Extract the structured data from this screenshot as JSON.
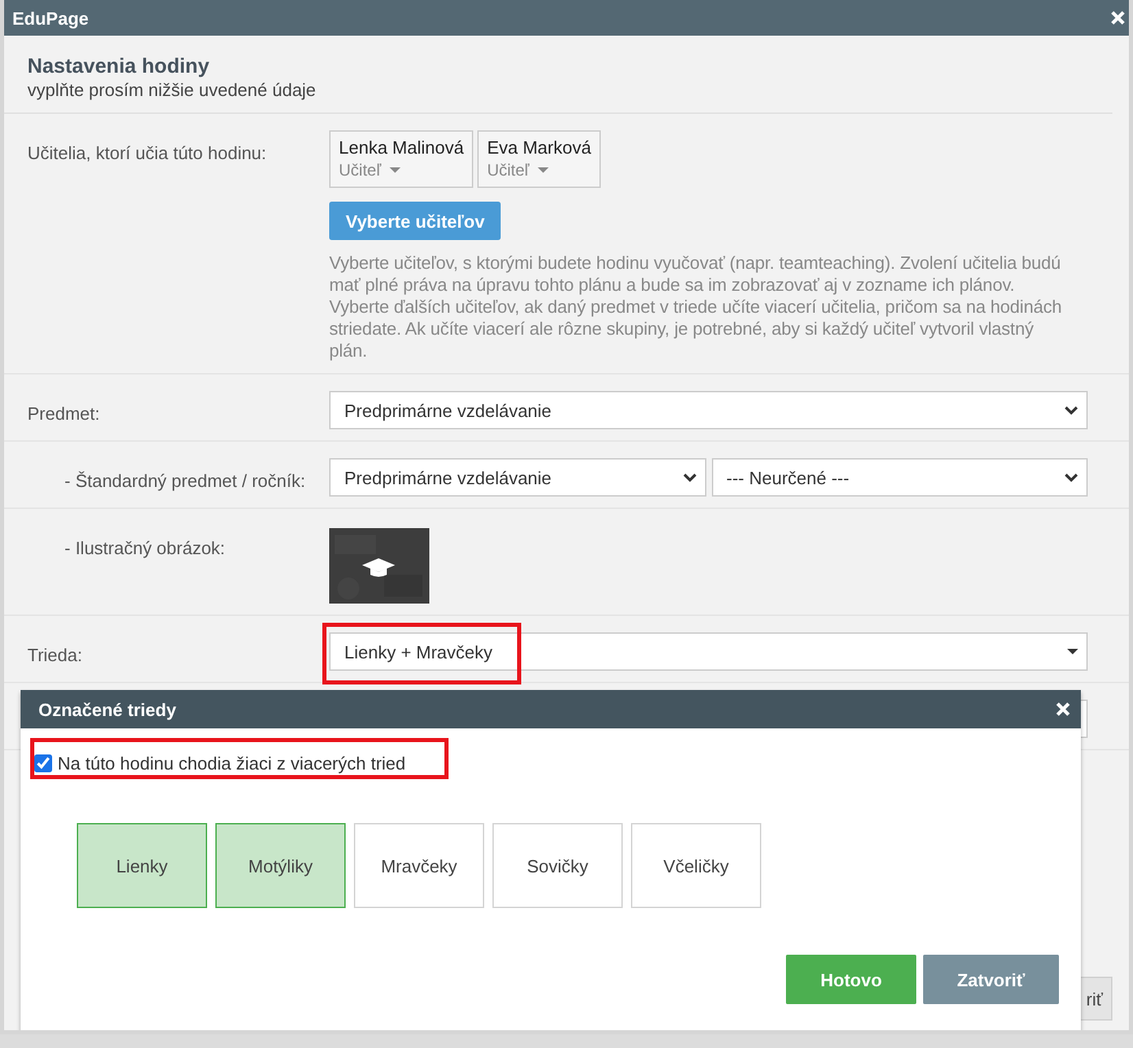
{
  "window": {
    "title": "EduPage"
  },
  "form": {
    "title": "Nastavenia hodiny",
    "subtitle": "vyplňte prosím nižšie uvedené údaje",
    "teachers": {
      "label": "Učitelia, ktorí učia túto hodinu:",
      "items": [
        {
          "name": "Lenka Malinová",
          "role": "Učiteľ"
        },
        {
          "name": "Eva Marková",
          "role": "Učiteľ"
        }
      ],
      "button": "Vyberte učiteľov",
      "help": "Vyberte učiteľov, s ktorými budete hodinu vyučovať (napr. teamteaching). Zvolení učitelia budú mať plné práva na úpravu tohto plánu a bude sa im zobrazovať aj v zozname ich plánov. Vyberte ďalších učiteľov, ak daný predmet v triede učíte viacerí učitelia, pričom sa na hodinách striedate. Ak učíte viacerí ale rôzne skupiny, je potrebné, aby si každý učiteľ vytvoril vlastný plán."
    },
    "subject": {
      "label": "Predmet:",
      "value": "Predprimárne vzdelávanie"
    },
    "standard_subject": {
      "label": "- Štandardný predmet / ročník:",
      "values": [
        "Predprimárne vzdelávanie",
        "--- Neurčené ---"
      ]
    },
    "illustration": {
      "label": "- Ilustračný obrázok:"
    },
    "class": {
      "label": "Trieda:",
      "value": "Lienky + Mravčeky",
      "highlighted": true
    },
    "footer_button": "riť"
  },
  "dialog": {
    "title": "Označené triedy",
    "multi_class": {
      "label": "Na túto hodinu chodia žiaci z viacerých tried",
      "checked": true,
      "highlighted": true
    },
    "classes": [
      {
        "label": "Lienky",
        "selected": true
      },
      {
        "label": "Motýliky",
        "selected": true
      },
      {
        "label": "Mravčeky",
        "selected": false
      },
      {
        "label": "Sovičky",
        "selected": false
      },
      {
        "label": "Včeličky",
        "selected": false
      }
    ],
    "buttons": [
      {
        "label": "Hotovo",
        "kind": "primary"
      },
      {
        "label": "Zatvoriť",
        "kind": "secondary"
      }
    ]
  }
}
